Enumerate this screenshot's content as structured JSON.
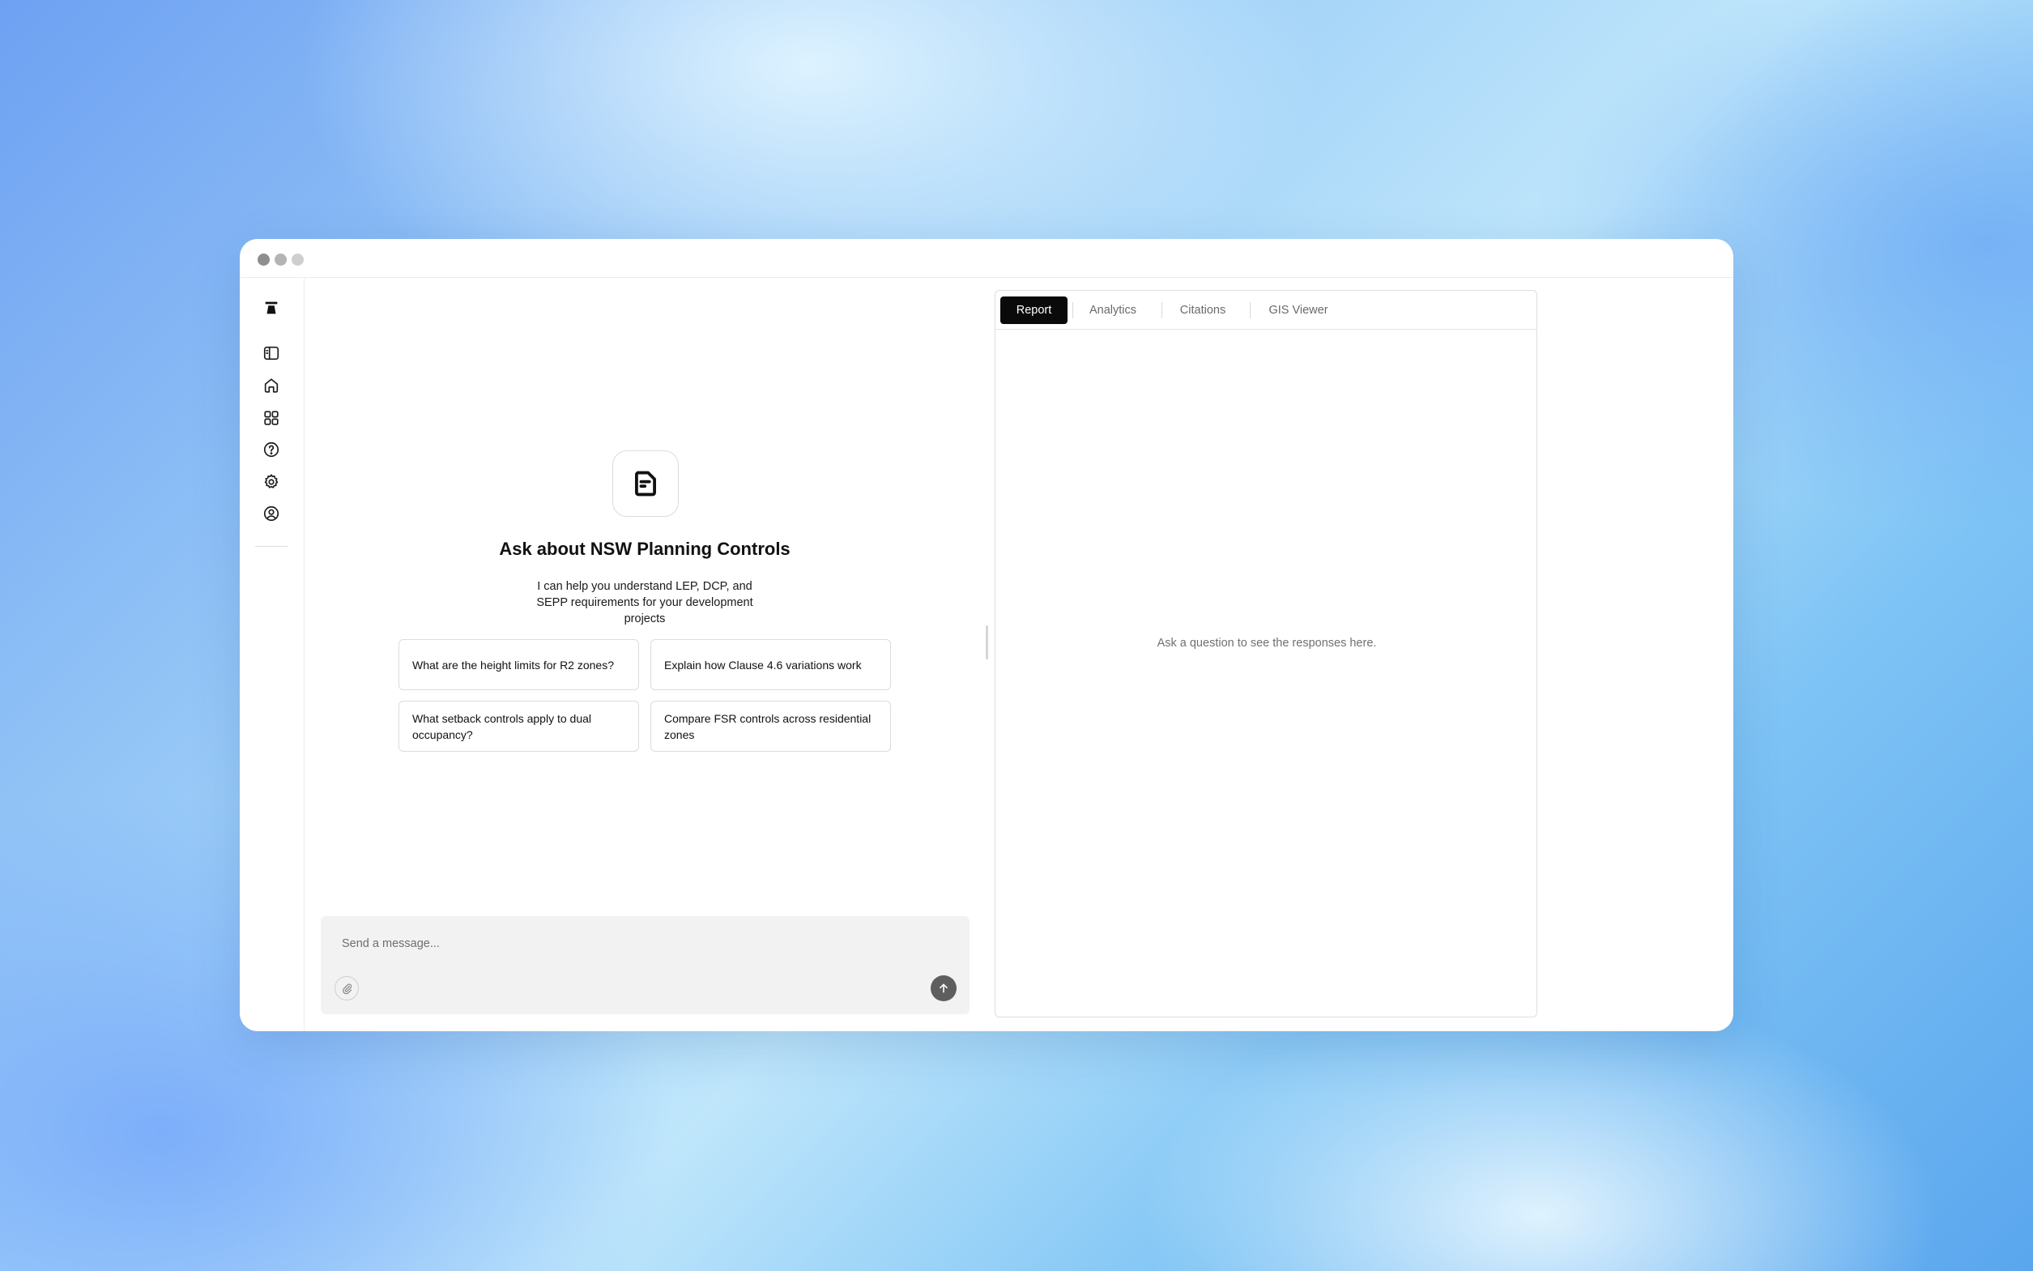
{
  "window": {
    "controls": [
      "close",
      "minimize",
      "maximize"
    ]
  },
  "sidebar": {
    "logo": "logo-icon",
    "items": [
      {
        "name": "toggle-sidebar",
        "icon": "sidebar-panel-icon"
      },
      {
        "name": "home",
        "icon": "home-icon"
      },
      {
        "name": "apps",
        "icon": "grid-icon"
      },
      {
        "name": "help",
        "icon": "help-circle-icon"
      },
      {
        "name": "settings",
        "icon": "gear-icon"
      },
      {
        "name": "account",
        "icon": "user-circle-icon"
      }
    ]
  },
  "chat": {
    "hero_icon": "document-icon",
    "title": "Ask about NSW Planning Controls",
    "subtitle": "I can help you understand LEP, DCP, and SEPP requirements for your development projects",
    "suggestions": [
      "What are the height limits for R2 zones?",
      "Explain how Clause 4.6 variations work",
      "What setback controls apply to dual occupancy?",
      "Compare FSR controls across residential zones"
    ],
    "composer": {
      "placeholder": "Send a message...",
      "attach_icon": "paperclip-icon",
      "send_icon": "arrow-up-icon"
    }
  },
  "panel": {
    "tabs": [
      {
        "label": "Report",
        "active": true
      },
      {
        "label": "Analytics",
        "active": false
      },
      {
        "label": "Citations",
        "active": false
      },
      {
        "label": "GIS Viewer",
        "active": false
      }
    ],
    "empty_message": "Ask a question to see the responses here."
  },
  "colors": {
    "active_tab_bg": "#0a0a0a",
    "send_button": "#5e5e5e",
    "composer_bg": "#f2f2f2"
  }
}
